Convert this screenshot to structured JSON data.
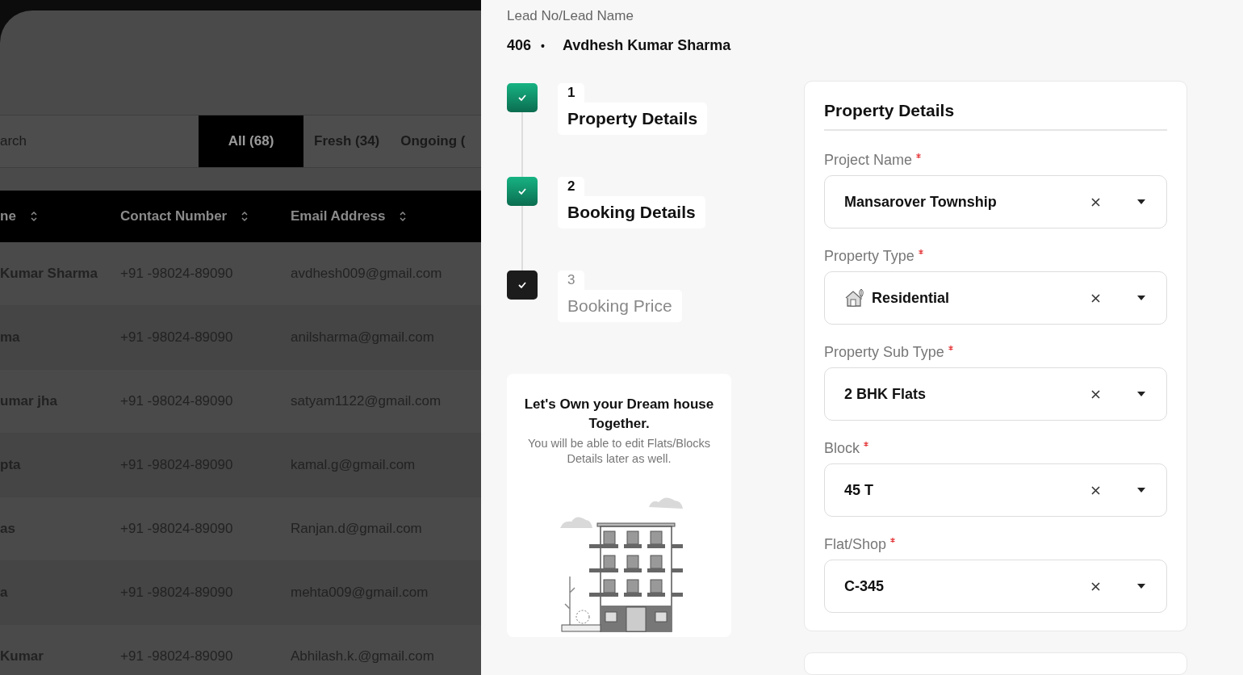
{
  "background_list": {
    "search": {
      "placeholder": "arch"
    },
    "tabs": [
      {
        "label": "All (68)",
        "selected": true
      },
      {
        "label": "Fresh (34)",
        "selected": false
      },
      {
        "label": "Ongoing (",
        "selected": false
      }
    ],
    "table": {
      "columns": [
        "ne",
        "Contact Number",
        "Email Address"
      ],
      "rows": [
        [
          "Kumar Sharma",
          "+91 -98024-89090",
          "avdhesh009@gmail.com"
        ],
        [
          "ma",
          "+91 -98024-89090",
          "anilsharma@gmail.com"
        ],
        [
          "umar jha",
          "+91 -98024-89090",
          "satyam1122@gmail.com"
        ],
        [
          "pta",
          "+91 -98024-89090",
          "kamal.g@gmail.com"
        ],
        [
          "as",
          "+91 -98024-89090",
          "Ranjan.d@gmail.com"
        ],
        [
          "a",
          "+91 -98024-89090",
          "mehta009@gmail.com"
        ],
        [
          "Kumar",
          "+91 -98024-89090",
          "Abhilash.k.@gmail.com"
        ]
      ]
    }
  },
  "lead": {
    "label": "Lead No/Lead Name",
    "number": "406",
    "separator": "•",
    "name": "Avdhesh Kumar Sharma"
  },
  "steps": [
    {
      "number": "1",
      "title": "Property Details",
      "completed": true
    },
    {
      "number": "2",
      "title": "Booking Details",
      "completed": true
    },
    {
      "number": "3",
      "title": "Booking Price",
      "completed": false
    }
  ],
  "promo": {
    "title": "Let's Own your Dream house Together.",
    "text": "You will be able to edit Flats/Blocks Details later as well."
  },
  "form": {
    "title": "Property Details",
    "fields": [
      {
        "label": "Project Name",
        "required": true,
        "value": "Mansarover Township",
        "kind": "plain"
      },
      {
        "label": "Property Type",
        "required": true,
        "value": "Residential",
        "kind": "iconic"
      },
      {
        "label": "Property Sub Type",
        "required": true,
        "value": "2 BHK Flats",
        "kind": "plain"
      },
      {
        "label": "Block",
        "required": true,
        "value": "45 T",
        "kind": "plain"
      },
      {
        "label": "Flat/Shop",
        "required": true,
        "value": "C-345",
        "kind": "plain"
      }
    ]
  }
}
